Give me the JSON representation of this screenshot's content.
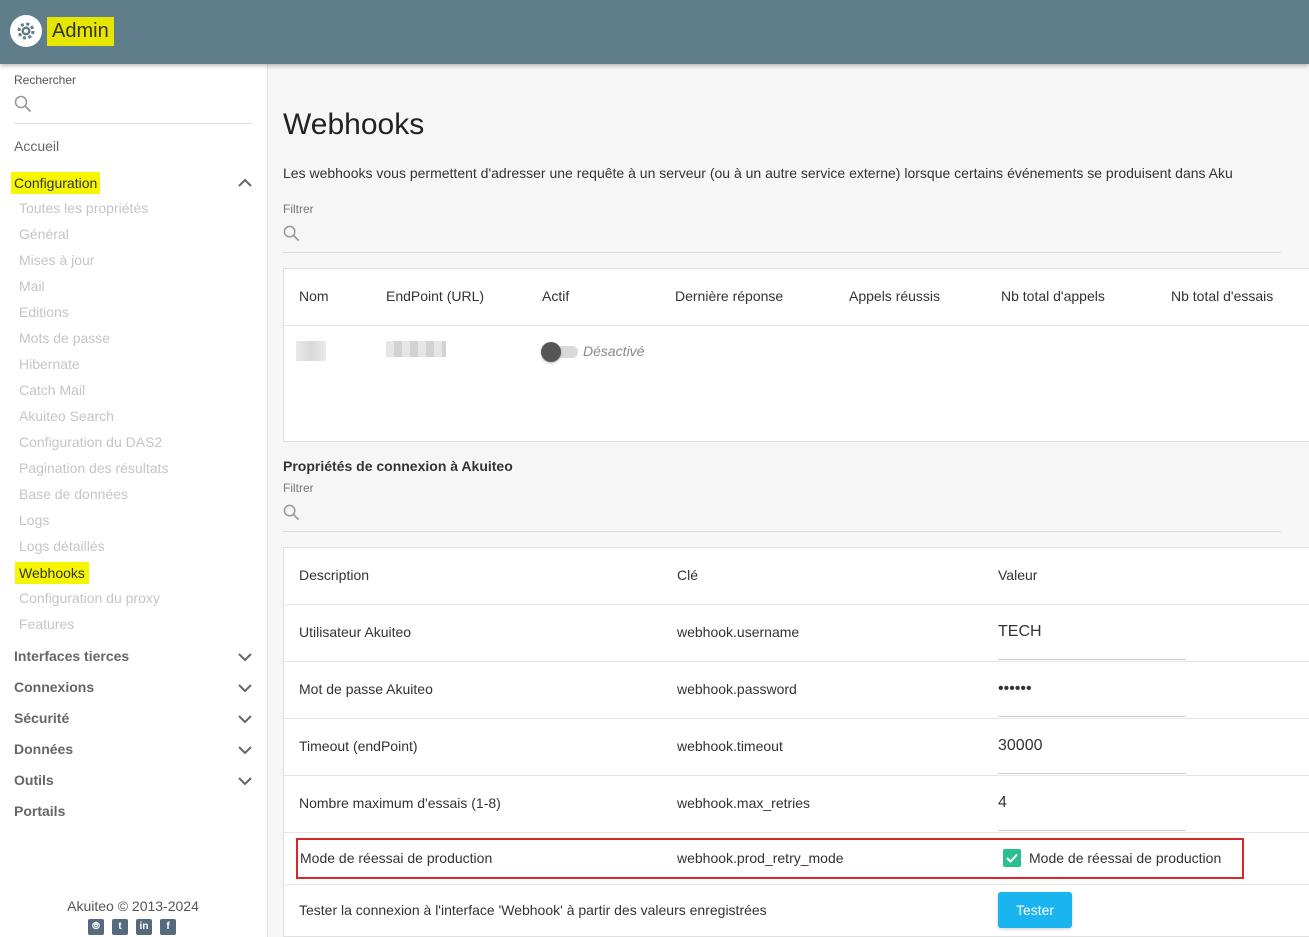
{
  "header": {
    "title": "Admin",
    "icon": "gear-icon"
  },
  "sidebar": {
    "search_label": "Rechercher",
    "home": "Accueil",
    "configuration": "Configuration",
    "config_items": [
      "Toutes les propriétés",
      "Général",
      "Mises à jour",
      "Mail",
      "Editions",
      "Mots de passe",
      "Hibernate",
      "Catch Mail",
      "Akuiteo Search",
      "Configuration du DAS2",
      "Pagination des résultats",
      "Base de données",
      "Logs",
      "Logs détaillés",
      "Webhooks",
      "Configuration du proxy",
      "Features"
    ],
    "active_item": "Webhooks",
    "groups": [
      "Interfaces tierces",
      "Connexions",
      "Sécurité",
      "Données",
      "Outils"
    ],
    "portals": "Portails",
    "footer": "Akuiteo © 2013-2024",
    "social_icons": [
      "analytics-icon",
      "twitter-icon",
      "linkedin-icon",
      "facebook-icon"
    ]
  },
  "main": {
    "title": "Webhooks",
    "description": "Les webhooks vous permettent d'adresser une requête à un serveur (ou à un autre service externe) lorsque certains événements se produisent dans Aku",
    "filter_label": "Filtrer",
    "webhooks_table": {
      "headers": [
        "Nom",
        "EndPoint (URL)",
        "Actif",
        "Dernière réponse",
        "Appels réussis",
        "Nb total d'appels",
        "Nb total d'essais"
      ],
      "row": {
        "actif": false,
        "actif_label": "Désactivé"
      }
    },
    "connection_section": {
      "title": "Propriétés de connexion à Akuiteo",
      "filter_label": "Filtrer",
      "headers": [
        "Description",
        "Clé",
        "Valeur"
      ],
      "rows": [
        {
          "description": "Utilisateur Akuiteo",
          "key": "webhook.username",
          "value": "TECH"
        },
        {
          "description": "Mot de passe Akuiteo",
          "key": "webhook.password",
          "value": "••••••"
        },
        {
          "description": "Timeout (endPoint)",
          "key": "webhook.timeout",
          "value": "30000"
        },
        {
          "description": "Nombre maximum d'essais (1-8)",
          "key": "webhook.max_retries",
          "value": "4"
        }
      ],
      "retry_row": {
        "description": "Mode de réessai de production",
        "key": "webhook.prod_retry_mode",
        "checkbox_label": "Mode de réessai de production",
        "checked": true
      },
      "test_row": {
        "description": "Tester la connexion à l'interface 'Webhook' à partir des valeurs enregistrées",
        "button": "Tester"
      }
    }
  },
  "colors": {
    "topbar": "#607d8b",
    "highlight": "#f6f600",
    "button": "#1ab4f0",
    "checkbox": "#2bbf8f",
    "annotation": "#d62828"
  }
}
